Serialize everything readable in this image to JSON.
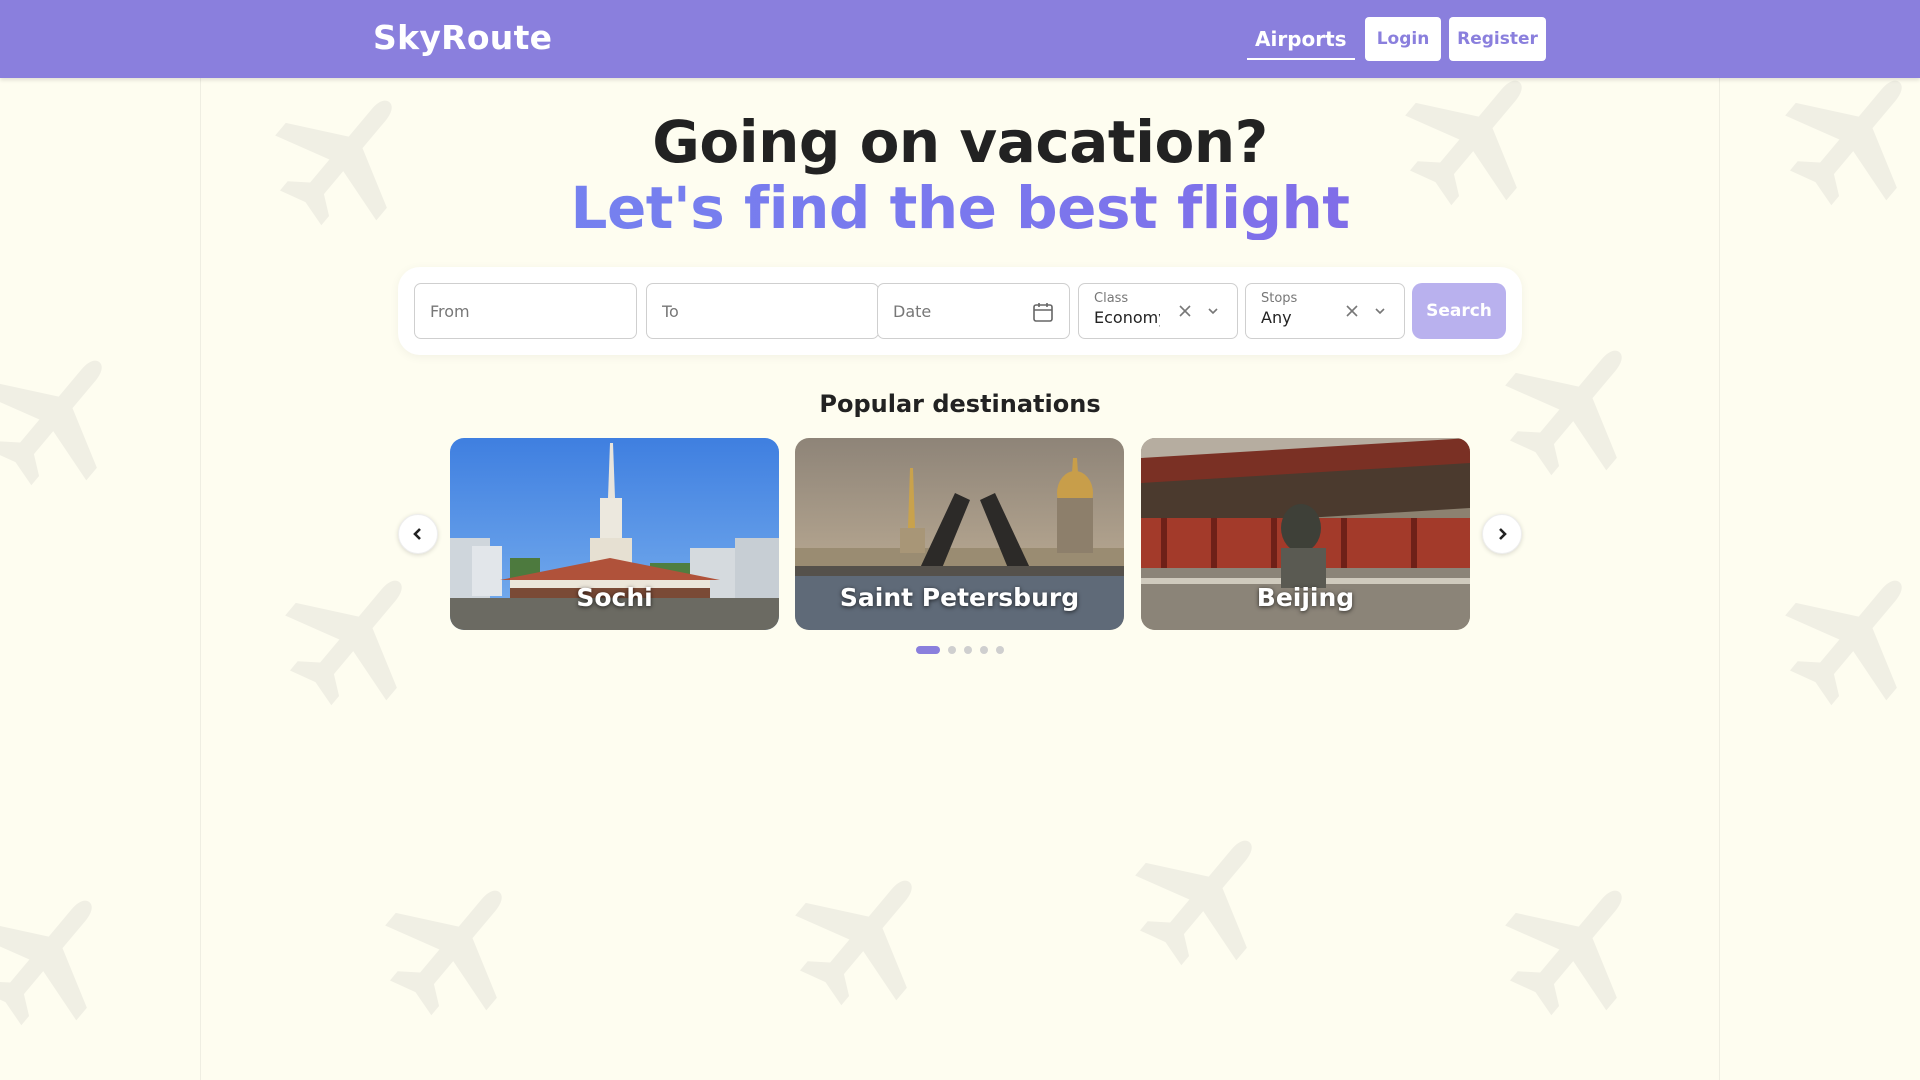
{
  "header": {
    "logo": "SkyRoute",
    "nav_airports": "Airports",
    "login_label": "Login",
    "register_label": "Register"
  },
  "hero": {
    "line1": "Going on vacation?",
    "line2": "Let's find the best flight"
  },
  "search": {
    "from_placeholder": "From",
    "to_placeholder": "To",
    "date_placeholder": "Date",
    "class_label": "Class",
    "class_value": "Economy",
    "stops_label": "Stops",
    "stops_value": "Any",
    "search_label": "Search"
  },
  "popular": {
    "title": "Popular destinations",
    "destinations": [
      {
        "name": "Sochi"
      },
      {
        "name": "Saint Petersburg"
      },
      {
        "name": "Beijing"
      }
    ],
    "carousel": {
      "pages": 5,
      "active_page": 1
    }
  },
  "icons": {
    "calendar": "calendar-icon",
    "clear": "close-icon",
    "dropdown": "chevron-down-icon",
    "prev": "chevron-left-icon",
    "next": "chevron-right-icon"
  },
  "colors": {
    "header_bg": "#8a7fdd",
    "page_bg": "#fefdf0",
    "gradient_start": "#6e8ef0",
    "gradient_end": "#8a5fe0",
    "search_button": "#b9b1ee"
  }
}
